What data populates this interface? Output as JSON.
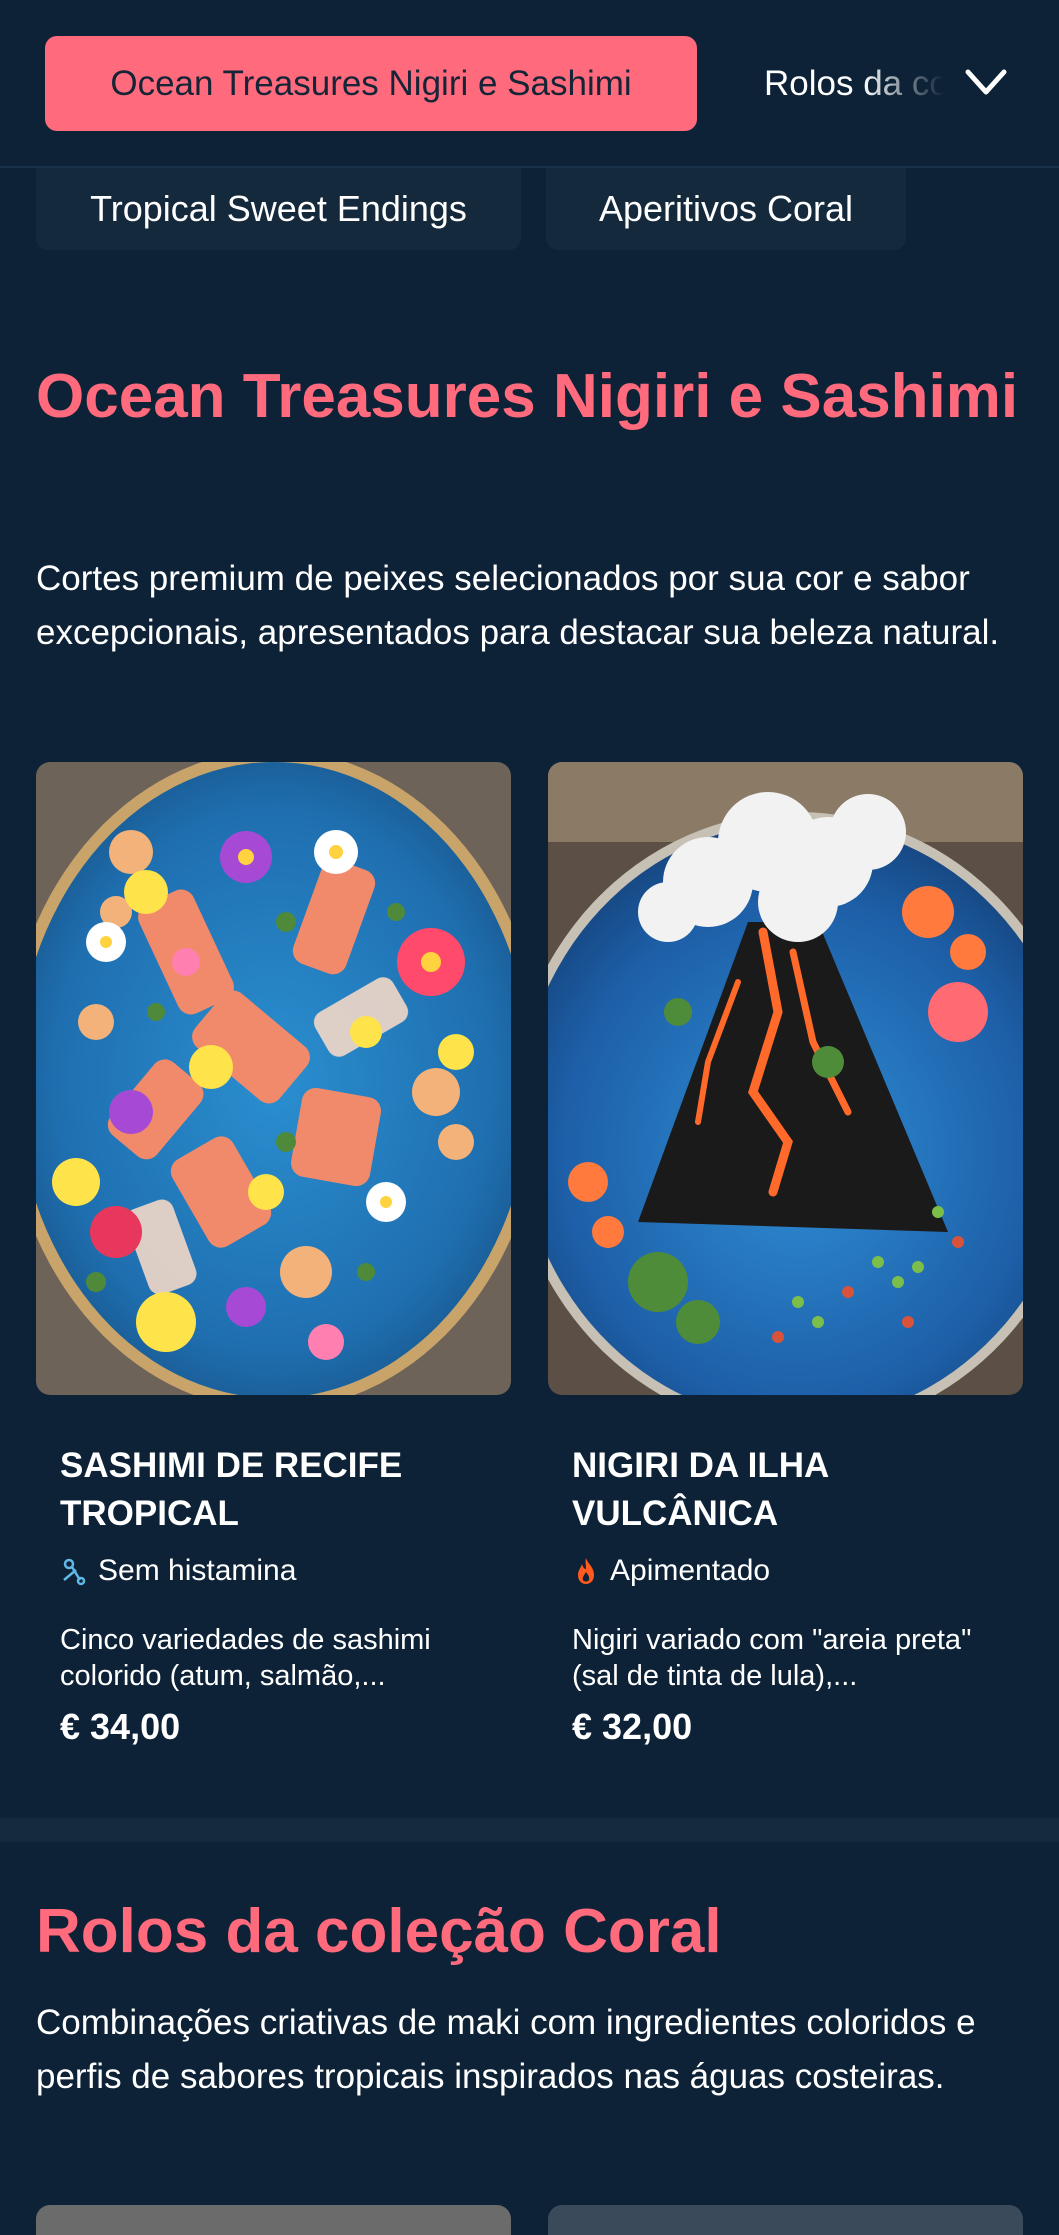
{
  "nav": {
    "active_category": "Ocean Treasures Nigiri e Sashimi",
    "next_category": "Rolos da coleção Coral",
    "expand_icon": "chevron-down-icon",
    "sub_categories": [
      "Tropical Sweet Endings",
      "Aperitivos Coral"
    ]
  },
  "sections": [
    {
      "title": "Ocean Treasures Nigiri e Sashimi",
      "description": "Cortes premium de peixes selecionados por sua cor e sabor excepcionais, apresentados para destacar sua beleza natural.",
      "items": [
        {
          "name": "SASHIMI DE RECIFE TROPICAL",
          "tag": "Sem histamina",
          "tag_icon": "histamine-free-icon",
          "description": "Cinco variedades de sashimi colorido (atum, salmão,...",
          "price": "€ 34,00"
        },
        {
          "name": "NIGIRI DA ILHA VULCÂNICA",
          "tag": "Apimentado",
          "tag_icon": "flame-icon",
          "description": "Nigiri variado com \"areia preta\" (sal de tinta de lula),...",
          "price": "€ 32,00"
        }
      ]
    },
    {
      "title": "Rolos da coleção Coral",
      "description": "Combinações criativas de maki com ingredientes coloridos e perfis de sabores tropicais inspirados nas águas costeiras."
    }
  ],
  "colors": {
    "background": "#0d2236",
    "accent": "#ff6b7d",
    "chip": "#15293d",
    "text": "#ffffff"
  }
}
